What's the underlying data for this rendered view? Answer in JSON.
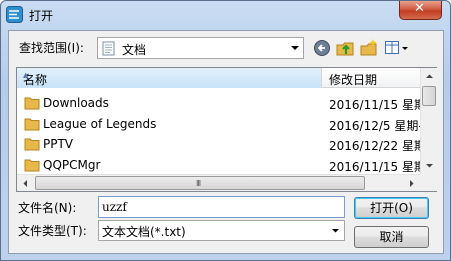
{
  "window": {
    "title": "打开",
    "close_glyph": "✕"
  },
  "toolbar": {
    "look_in_label": "查找范围(I):",
    "look_in_value": "文档",
    "icons": [
      "back-icon",
      "up-folder-icon",
      "new-folder-icon",
      "view-menu-icon"
    ]
  },
  "file_list": {
    "columns": {
      "name": "名称",
      "date": "修改日期"
    },
    "rows": [
      {
        "name": "Downloads",
        "date": "2016/11/15 星期"
      },
      {
        "name": "League of Legends",
        "date": "2016/12/5 星期-"
      },
      {
        "name": "PPTV",
        "date": "2016/12/22 星期"
      },
      {
        "name": "QQPCMgr",
        "date": "2016/11/15 星期"
      }
    ],
    "hscroll_grip": "III"
  },
  "form": {
    "filename_label": "文件名(N):",
    "filename_value": "uzzf",
    "filetype_label": "文件类型(T):",
    "filetype_value": "文本文档(*.txt)"
  },
  "buttons": {
    "open": "打开(O)",
    "cancel": "取消"
  },
  "colors": {
    "title_bar": "#bcd1ec",
    "close": "#c23d21",
    "folder": "#e8b84a"
  }
}
